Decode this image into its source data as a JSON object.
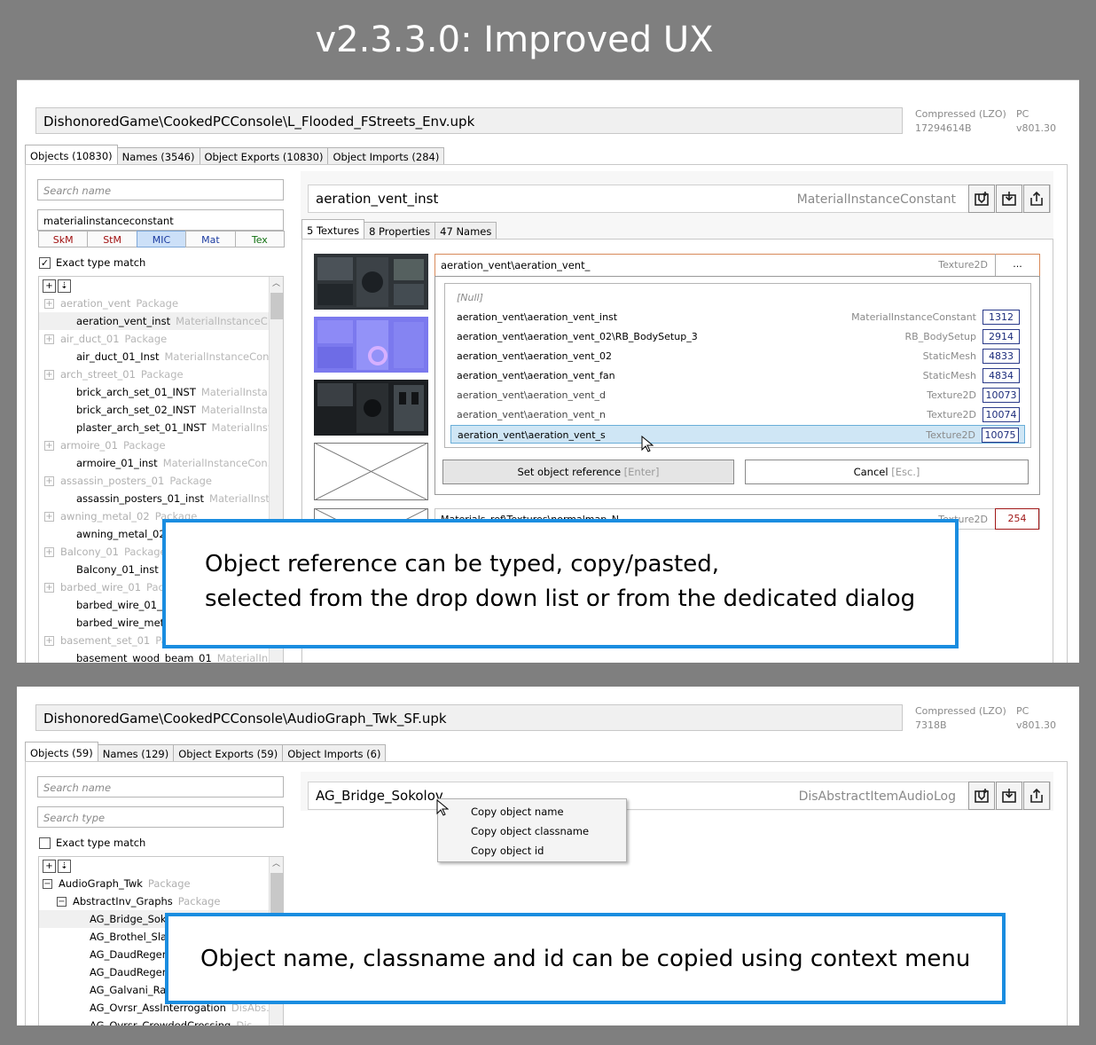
{
  "title": "v2.3.3.0: Improved UX",
  "colors": {
    "callout_border": "#1a8de0",
    "selection_bg": "#cfe6f5",
    "filter_active_bg": "#cce0f8",
    "dropdown_border": "#d88a5a"
  },
  "panel1": {
    "path": "DishonoredGame\\CookedPCConsole\\L_Flooded_FStreets_Env.upk",
    "info": {
      "compression": "Compressed (LZO)",
      "size": "17294614B",
      "platform": "PC",
      "version": "v801.30"
    },
    "tabs": [
      "Objects (10830)",
      "Names (3546)",
      "Object Exports (10830)",
      "Object Imports (284)"
    ],
    "search_name_placeholder": "Search name",
    "search_type_value": "materialinstanceconstant",
    "filters": [
      {
        "label": "SkM",
        "color": "#a01010"
      },
      {
        "label": "StM",
        "color": "#a01010"
      },
      {
        "label": "MIC",
        "color": "#1a3aa0"
      },
      {
        "label": "Mat",
        "color": "#1a3aa0"
      },
      {
        "label": "Tex",
        "color": "#107010"
      }
    ],
    "exact_type_match": {
      "label": "Exact type match",
      "checked": true
    },
    "tree": [
      {
        "name": "aeration_vent",
        "cls": "Package",
        "pkg": true
      },
      {
        "name": "aeration_vent_inst",
        "cls": "MaterialInstanceC...",
        "pkg": false,
        "sel": true
      },
      {
        "name": "air_duct_01",
        "cls": "Package",
        "pkg": true
      },
      {
        "name": "air_duct_01_Inst",
        "cls": "MaterialInstanceCon...",
        "pkg": false
      },
      {
        "name": "arch_street_01",
        "cls": "Package",
        "pkg": true
      },
      {
        "name": "brick_arch_set_01_INST",
        "cls": "MaterialInsta...",
        "pkg": false
      },
      {
        "name": "brick_arch_set_02_INST",
        "cls": "MaterialInsta...",
        "pkg": false
      },
      {
        "name": "plaster_arch_set_01_INST",
        "cls": "MaterialInst...",
        "pkg": false
      },
      {
        "name": "armoire_01",
        "cls": "Package",
        "pkg": true
      },
      {
        "name": "armoire_01_inst",
        "cls": "MaterialInstanceCon...",
        "pkg": false
      },
      {
        "name": "assassin_posters_01",
        "cls": "Package",
        "pkg": true
      },
      {
        "name": "assassin_posters_01_inst",
        "cls": "MaterialInst...",
        "pkg": false
      },
      {
        "name": "awning_metal_02",
        "cls": "Package",
        "pkg": true
      },
      {
        "name": "awning_metal_02_",
        "cls": "",
        "pkg": false
      },
      {
        "name": "Balcony_01",
        "cls": "Package",
        "pkg": true
      },
      {
        "name": "Balcony_01_inst",
        "cls": "M",
        "pkg": false
      },
      {
        "name": "barbed_wire_01",
        "cls": "Pack",
        "pkg": true
      },
      {
        "name": "barbed_wire_01__I",
        "cls": "",
        "pkg": false
      },
      {
        "name": "barbed_wire_meta",
        "cls": "",
        "pkg": false
      },
      {
        "name": "basement_set_01",
        "cls": "Pa",
        "pkg": true
      },
      {
        "name": "basement_wood_beam_01",
        "cls": "MaterialIn...",
        "pkg": false
      }
    ],
    "object": {
      "name": "aeration_vent_inst",
      "cls": "MaterialInstanceConstant"
    },
    "obj_tabs": [
      "5 Textures",
      "8 Properties",
      "47 Names"
    ],
    "dropdown": {
      "value": "aeration_vent\\aeration_vent_",
      "cls": "Texture2D",
      "browse": "..."
    },
    "ref_list": [
      {
        "name": "[Null]",
        "cls": "",
        "id": "",
        "null": true
      },
      {
        "name": "aeration_vent\\aeration_vent_inst",
        "cls": "MaterialInstanceConstant",
        "id": "1312"
      },
      {
        "name": "aeration_vent\\aeration_vent_02\\RB_BodySetup_3",
        "cls": "RB_BodySetup",
        "id": "2914"
      },
      {
        "name": "aeration_vent\\aeration_vent_02",
        "cls": "StaticMesh",
        "id": "4833"
      },
      {
        "name": "aeration_vent\\aeration_vent_fan",
        "cls": "StaticMesh",
        "id": "4834"
      },
      {
        "name": "aeration_vent\\aeration_vent_d",
        "cls": "Texture2D",
        "id": "10073"
      },
      {
        "name": "aeration_vent\\aeration_vent_n",
        "cls": "Texture2D",
        "id": "10074"
      },
      {
        "name": "aeration_vent\\aeration_vent_s",
        "cls": "Texture2D",
        "id": "10075",
        "hl": true
      }
    ],
    "set_ref": {
      "label": "Set object reference",
      "hint": "[Enter]"
    },
    "cancel": {
      "label": "Cancel",
      "hint": "[Esc.]"
    },
    "next_row": {
      "name": "Materials_ref\\Textures\\normalmap_N",
      "cls": "Texture2D",
      "id": "254"
    },
    "callout": [
      "Object reference can be typed, copy/pasted,",
      "selected from the drop down list or from the dedicated dialog"
    ]
  },
  "panel2": {
    "path": "DishonoredGame\\CookedPCConsole\\AudioGraph_Twk_SF.upk",
    "info": {
      "compression": "Compressed (LZO)",
      "size": "7318B",
      "platform": "PC",
      "version": "v801.30"
    },
    "tabs": [
      "Objects (59)",
      "Names (129)",
      "Object Exports (59)",
      "Object Imports (6)"
    ],
    "search_name_placeholder": "Search name",
    "search_type_placeholder": "Search type",
    "exact_type_match": {
      "label": "Exact type match",
      "checked": false
    },
    "tree": [
      {
        "name": "AudioGraph_Twk",
        "cls": "Package",
        "level": 0
      },
      {
        "name": "AbstractInv_Graphs",
        "cls": "Package",
        "level": 1
      },
      {
        "name": "AG_Bridge_Soko",
        "cls": "",
        "level": 2,
        "sel": true
      },
      {
        "name": "AG_Brothel_Slac",
        "cls": "",
        "level": 2
      },
      {
        "name": "AG_DaudRegen",
        "cls": "",
        "level": 2
      },
      {
        "name": "AG_DaudRegen",
        "cls": "",
        "level": 2
      },
      {
        "name": "AG_Galvani_Rat",
        "cls": "",
        "level": 2
      },
      {
        "name": "AG_Ovrsr_AssInterrogation",
        "cls": "DisAbs...",
        "level": 2
      },
      {
        "name": "AG_Ovrsr_CrowdedCrossing",
        "cls": "Dis...",
        "level": 2
      }
    ],
    "object": {
      "name": "AG_Bridge_Sokolov",
      "cls": "DisAbstractItemAudioLog"
    },
    "context_menu": [
      "Copy object name",
      "Copy object classname",
      "Copy object id"
    ],
    "callout": "Object name, classname and id can be copied using context menu"
  }
}
